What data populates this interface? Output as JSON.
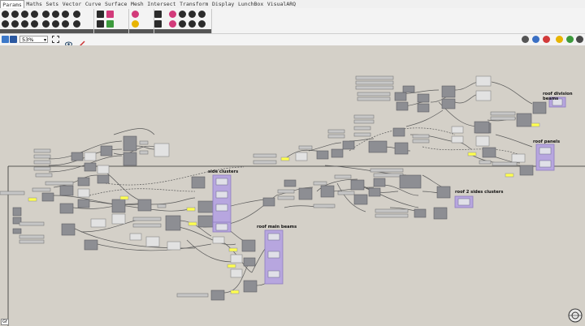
{
  "menu": {
    "tabs": [
      "Params",
      "Maths",
      "Sets",
      "Vector",
      "Curve",
      "Surface",
      "Mesh",
      "Intersect",
      "Transform",
      "Display",
      "LunchBox",
      "VisualARQ"
    ],
    "active_tab": "Params"
  },
  "toolbar": {
    "zoom_level": "53%"
  },
  "groups": {
    "roof_division_beams": "roof division beams",
    "roof_panels": "roof panels",
    "side_clusters": "side clusters",
    "roof_2_sides_clusters": "roof 2 sides clusters",
    "roof_main_beams": "roof main beams"
  },
  "status": {
    "corner_label": "Gf"
  },
  "colors": {
    "canvas": "#d4d0c8",
    "component": "#8d8e93",
    "panel": "#b7a6df",
    "slider": "#ffff4f"
  }
}
